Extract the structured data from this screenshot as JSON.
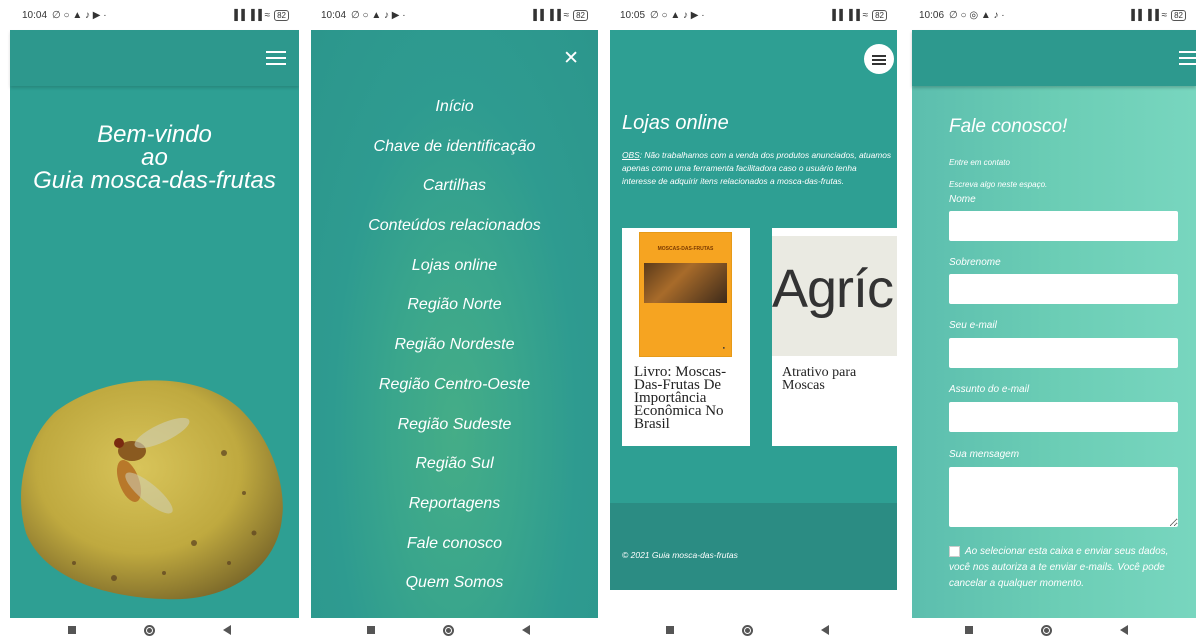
{
  "screens": [
    {
      "status": {
        "time": "10:04",
        "icons": "∅ ○ ▲ ♪ ▶ ·",
        "signal": "▐▐ ▐▐ ≈",
        "battery": "82"
      },
      "welcome": [
        "Bem-vindo",
        "ao",
        "Guia mosca-das-frutas"
      ]
    },
    {
      "status": {
        "time": "10:04",
        "icons": "∅ ○ ▲ ♪ ▶ ·",
        "signal": "▐▐ ▐▐ ≈",
        "battery": "82"
      },
      "menu": [
        "Início",
        "Chave de identificação",
        "Cartilhas",
        "Conteúdos relacionados",
        "Lojas online",
        "Região Norte",
        "Região Nordeste",
        "Região Centro-Oeste",
        "Região Sudeste",
        "Região Sul",
        "Reportagens",
        "Fale conosco",
        "Quem Somos"
      ]
    },
    {
      "status": {
        "time": "10:05",
        "icons": "∅ ○ ▲ ♪ ▶ ·",
        "signal": "▐▐ ▐▐ ≈",
        "battery": "82"
      },
      "title": "Lojas online",
      "obs_label": "OBS",
      "obs_text": ": Não trabalhamos com a venda dos produtos anunciados, atuamos apenas como uma ferramenta facilitadora caso o usuário tenha interesse de adquirir itens relacionados a mosca-das-frutas.",
      "cards": [
        {
          "book_cover_title": "MOSCAS-DAS-FRUTAS",
          "book_publisher": "●",
          "title": "Livro: Moscas-Das-Frutas De Importância Econômica No Brasil"
        },
        {
          "image_text": "Agríc",
          "title": "Atrativo para Moscas"
        }
      ],
      "copyright": "© 2021 Guia mosca-das-frutas"
    },
    {
      "status": {
        "time": "10:06",
        "icons": "∅ ○ ◎ ▲ ♪ ·",
        "signal": "▐▐ ▐▐ ≈",
        "battery": "82"
      },
      "title": "Fale conosco!",
      "line1": "Entre em contato",
      "line2": "Escreva algo neste espaço.",
      "fields": [
        "Nome",
        "Sobrenome",
        "Seu e-mail",
        "Assunto do e-mail",
        "Sua mensagem"
      ],
      "consent": "Ao selecionar esta caixa e enviar seus dados, você nos autoriza a te enviar e-mails. Você pode cancelar a qualquer momento."
    }
  ]
}
